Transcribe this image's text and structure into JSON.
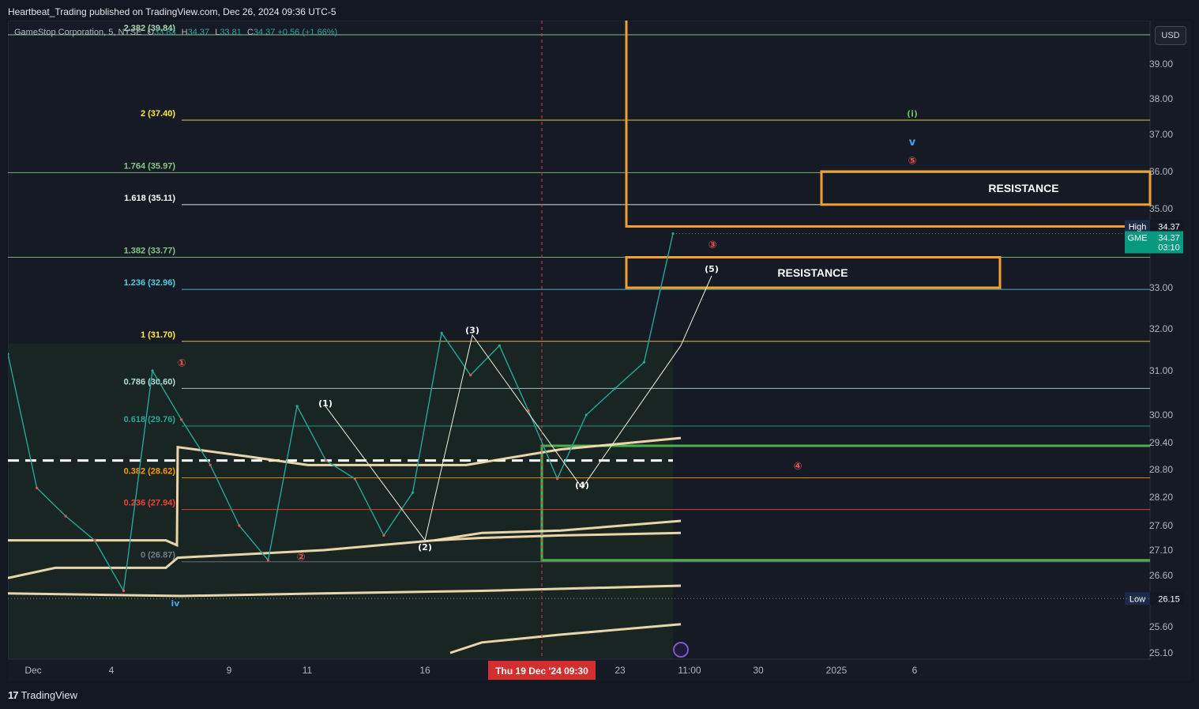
{
  "header": {
    "publisher_line": "Heartbeat_Trading published on TradingView.com, Dec 26, 2024 09:36 UTC-5"
  },
  "legend": {
    "symbol": "GameStop Corporation, 5, NYSE",
    "open_label": "O",
    "open": "33.83",
    "high_label": "H",
    "high": "34.37",
    "low_label": "L",
    "low": "33.81",
    "close_label": "C",
    "close": "34.37",
    "change": "+0.56 (+1.66%)"
  },
  "toolbar": {
    "currency": "USD"
  },
  "footer": {
    "brand": "TradingView",
    "logo_glyph": "17"
  },
  "colors": {
    "background": "#131722",
    "chart_bg": "#161a25",
    "up": "#26a69a",
    "down": "#ef5350",
    "orange_box": "#f0a030",
    "green_line": "#4caf50",
    "cream": "#f5deb3",
    "crosshair": "#e0314b"
  },
  "chart_data": {
    "type": "line",
    "title": "",
    "ylim": [
      24.9,
      40.2
    ],
    "y_ticks": [
      "39.00",
      "38.00",
      "37.00",
      "36.00",
      "35.00",
      "33.00",
      "32.00",
      "31.00",
      "30.00",
      "29.40",
      "28.80",
      "28.20",
      "27.60",
      "27.10",
      "26.60",
      "25.60",
      "25.10"
    ],
    "y_tick_values": [
      39.0,
      38.0,
      37.0,
      36.0,
      35.0,
      33.0,
      32.0,
      31.0,
      30.0,
      29.4,
      28.8,
      28.2,
      27.6,
      27.1,
      26.6,
      25.6,
      25.1
    ],
    "x_ticks": [
      "Dec",
      "4",
      "9",
      "11",
      "16",
      "23",
      "11:00",
      "30",
      "2025",
      "6"
    ],
    "crosshair_date_label": "Thu 19 Dec '24   09:30",
    "price_series": {
      "name": "GME",
      "points": [
        [
          "Nov 29",
          31.4
        ],
        [
          "Dec 2",
          28.4
        ],
        [
          "Dec 3",
          27.8
        ],
        [
          "Dec 5",
          27.3
        ],
        [
          "Dec 6",
          26.3
        ],
        [
          "Dec 6 close",
          31.0
        ],
        [
          "Dec 9",
          29.9
        ],
        [
          "Dec 9 mid",
          28.9
        ],
        [
          "Dec 10",
          27.6
        ],
        [
          "Dec 10 low",
          26.9
        ],
        [
          "Dec 11",
          30.2
        ],
        [
          "Dec 12",
          29.0
        ],
        [
          "Dec 13",
          28.6
        ],
        [
          "Dec 16",
          27.4
        ],
        [
          "Dec 17",
          28.3
        ],
        [
          "Dec 18",
          31.9
        ],
        [
          "Dec 19",
          30.9
        ],
        [
          "Dec 19 high",
          31.6
        ],
        [
          "Dec 20",
          30.1
        ],
        [
          "Dec 20 low",
          28.6
        ],
        [
          "Dec 23",
          30.0
        ],
        [
          "Dec 24",
          30.6
        ],
        [
          "Dec 26",
          31.2
        ],
        [
          "Dec 26 09:35",
          34.37
        ]
      ]
    },
    "fibonacci_levels": [
      {
        "label": "2.382 (39.84)",
        "value": 39.84,
        "color": "#a5d6a7"
      },
      {
        "label": "2 (37.40)",
        "value": 37.4,
        "color": "#ffeb3b"
      },
      {
        "label": "1.764 (35.97)",
        "value": 35.97,
        "color": "#81c784"
      },
      {
        "label": "1.618 (35.11)",
        "value": 35.11,
        "color": "#ffffff"
      },
      {
        "label": "1.382 (33.77)",
        "value": 33.77,
        "color": "#81c784"
      },
      {
        "label": "1.236 (32.96)",
        "value": 32.96,
        "color": "#4dd0e1"
      },
      {
        "label": "1 (31.70)",
        "value": 31.7,
        "color": "#ffeb3b"
      },
      {
        "label": "0.786 (30.60)",
        "value": 30.6,
        "color": "#b2dfdb"
      },
      {
        "label": "0.618 (29.76)",
        "value": 29.76,
        "color": "#26a69a"
      },
      {
        "label": "0.382 (28.62)",
        "value": 28.62,
        "color": "#ff9800"
      },
      {
        "label": "0.236 (27.94)",
        "value": 27.94,
        "color": "#f44336"
      },
      {
        "label": "0 (26.87)",
        "value": 26.87,
        "color": "#787b86"
      }
    ],
    "zones": [
      {
        "label": "RESISTANCE",
        "top": 36.0,
        "bottom": 35.11
      },
      {
        "label": "RESISTANCE",
        "top": 33.77,
        "bottom": 33.0
      }
    ],
    "wave_labels": [
      {
        "text": "(1)",
        "price": 30.2
      },
      {
        "text": "(2)",
        "price": 27.1
      },
      {
        "text": "(3)",
        "price": 31.9
      },
      {
        "text": "(4)",
        "price": 28.4
      },
      {
        "text": "(5)",
        "price": 33.4
      },
      {
        "text": "①",
        "price": 31.1
      },
      {
        "text": "②",
        "price": 26.9
      },
      {
        "text": "③",
        "price": 34.0
      },
      {
        "text": "④",
        "price": 28.8
      },
      {
        "text": "⑤",
        "price": 36.2
      },
      {
        "text": "iv",
        "price": 26.0
      },
      {
        "text": "v",
        "price": 36.7
      },
      {
        "text": "(i)",
        "price": 37.5
      }
    ],
    "high_badge": {
      "label": "High",
      "value": "34.37"
    },
    "last_badge": {
      "label": "GME",
      "value": "34.37",
      "countdown": "03:10"
    },
    "low_badge": {
      "label": "Low",
      "value": "26.15"
    }
  }
}
